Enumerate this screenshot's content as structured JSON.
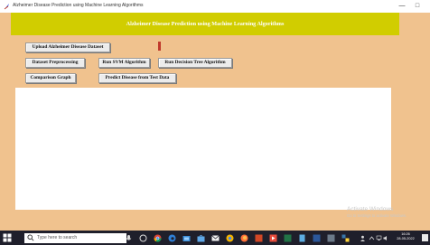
{
  "window": {
    "title": "Alzheimer Disease Prediction using Machine Learning Algorithms",
    "minimize_glyph": "—",
    "maximize_glyph": "□"
  },
  "header": {
    "title": "Alzheimer Disease Prediction using Machine Learning Algorithms"
  },
  "buttons": {
    "upload": "Upload Alzheimer Disease Dataset",
    "preprocess": "Dataset Preprocessing",
    "svm": "Run SVM Algorithm",
    "decision_tree": "Run Decision Tree Algorithm",
    "comparison": "Comparison Graph",
    "predict": "Predict Disease from Test Data"
  },
  "output": {
    "text": ""
  },
  "watermark": {
    "title": "Activate Windows",
    "subtitle": "Go to Settings to activate Windows."
  },
  "taskbar": {
    "search_placeholder": "Type here to search",
    "time": "16:26",
    "date": "28-05-2022"
  },
  "colors": {
    "background": "#f0c28e",
    "banner": "#d1cd00",
    "banner_text": "#ffffff",
    "marker": "#c0392b",
    "taskbar": "#1f1f2b"
  }
}
